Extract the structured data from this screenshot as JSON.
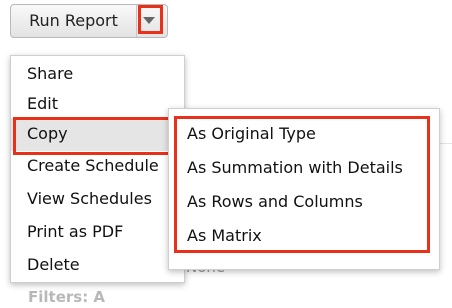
{
  "button": {
    "label": "Run Report",
    "caret_icon": "chevron-down-icon"
  },
  "menu": {
    "items": [
      "Share",
      "Edit",
      "Copy",
      "Create Schedule",
      "View Schedules",
      "Print as PDF",
      "Delete"
    ],
    "selected": "Copy"
  },
  "submenu": {
    "items": [
      "As Original Type",
      "As Summation with Details",
      "As Rows and Columns",
      "As Matrix"
    ]
  },
  "background": {
    "none_text": "None",
    "filters_text": "Filters: A"
  },
  "colors": {
    "highlight": "#e8301b",
    "hover_row": "#e5e5e5"
  }
}
